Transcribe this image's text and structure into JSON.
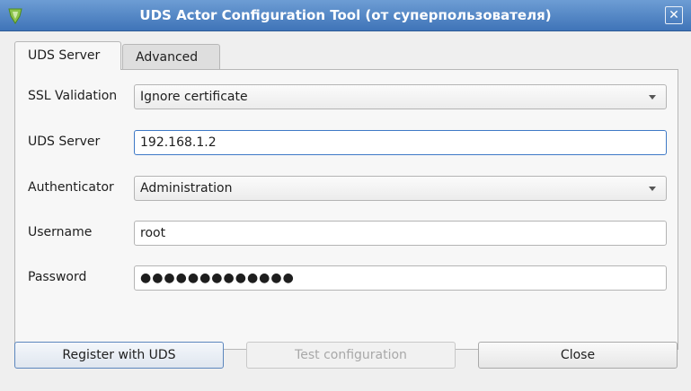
{
  "window": {
    "title": "UDS Actor Configuration Tool (от суперпользователя)",
    "close_glyph": "✕"
  },
  "tabs": [
    {
      "label": "UDS Server",
      "active": true
    },
    {
      "label": "Advanced",
      "active": false
    }
  ],
  "form": {
    "ssl_validation": {
      "label": "SSL Validation",
      "value": "Ignore certificate"
    },
    "uds_server": {
      "label": "UDS Server",
      "value": "192.168.1.2"
    },
    "authenticator": {
      "label": "Authenticator",
      "value": "Administration"
    },
    "username": {
      "label": "Username",
      "value": "root"
    },
    "password": {
      "label": "Password",
      "masked": "●●●●●●●●●●●●●"
    }
  },
  "buttons": {
    "register": "Register with UDS",
    "test": "Test configuration",
    "close": "Close"
  },
  "colors": {
    "titlebar": "#3f74b8",
    "focus": "#3e79c6"
  }
}
